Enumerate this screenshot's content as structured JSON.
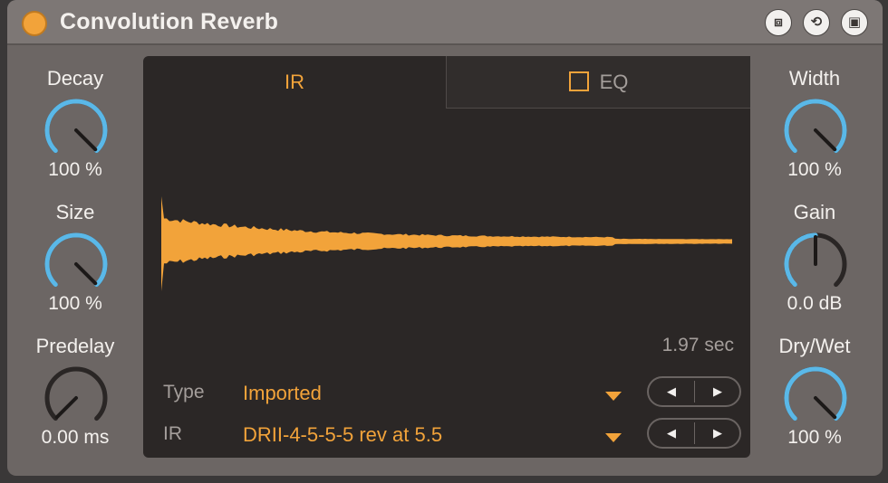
{
  "device": {
    "title": "Convolution Reverb",
    "colors": {
      "accent": "#f2a33a",
      "knob_arc": "#5ab8e8",
      "panel": "#6c6664",
      "display_bg": "#2b2726"
    },
    "header_buttons": [
      {
        "icon": "hot-swap-icon",
        "glyph": "⧈"
      },
      {
        "icon": "preset-reload-icon",
        "glyph": "⟲"
      },
      {
        "icon": "save-icon",
        "glyph": "▣"
      }
    ]
  },
  "left_knobs": [
    {
      "label": "Decay",
      "value": "100 %",
      "level": 1.0
    },
    {
      "label": "Size",
      "value": "100 %",
      "level": 1.0
    },
    {
      "label": "Predelay",
      "value": "0.00 ms",
      "level": 0.0
    }
  ],
  "right_knobs": [
    {
      "label": "Width",
      "value": "100 %",
      "level": 1.0
    },
    {
      "label": "Gain",
      "value": "0.0 dB",
      "level": 0.5
    },
    {
      "label": "Dry/Wet",
      "value": "100 %",
      "level": 1.0
    }
  ],
  "display": {
    "tabs": {
      "ir": "IR",
      "eq": "EQ"
    },
    "eq_enabled": false,
    "length": "1.97 sec",
    "type_label": "Type",
    "type_value": "Imported",
    "ir_label": "IR",
    "ir_value": "DRII-4-5-5-5 rev at 5.5",
    "stepper_prev_icon": "◀",
    "stepper_next_icon": "▶"
  }
}
